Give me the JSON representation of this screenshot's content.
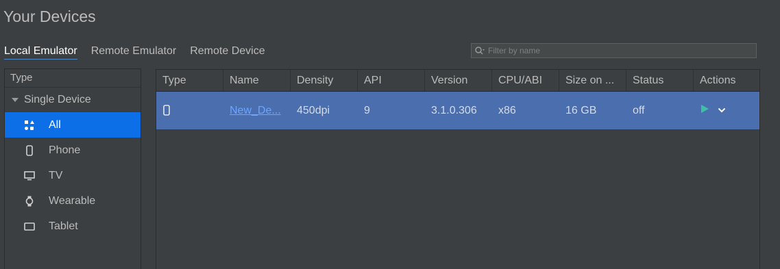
{
  "page": {
    "title": "Your Devices"
  },
  "tabs": [
    {
      "label": "Local Emulator",
      "active": true
    },
    {
      "label": "Remote Emulator",
      "active": false
    },
    {
      "label": "Remote Device",
      "active": false
    }
  ],
  "filter": {
    "placeholder": "Filter by name",
    "value": ""
  },
  "sidebar": {
    "header": "Type",
    "group": "Single Device",
    "items": [
      {
        "label": "All",
        "icon": "grid-shapes-icon",
        "selected": true
      },
      {
        "label": "Phone",
        "icon": "phone-icon",
        "selected": false
      },
      {
        "label": "TV",
        "icon": "tv-icon",
        "selected": false
      },
      {
        "label": "Wearable",
        "icon": "watch-icon",
        "selected": false
      },
      {
        "label": "Tablet",
        "icon": "tablet-icon",
        "selected": false
      }
    ]
  },
  "table": {
    "columns": [
      "Type",
      "Name",
      "Density",
      "API",
      "Version",
      "CPU/ABI",
      "Size on ...",
      "Status",
      "Actions"
    ],
    "rows": [
      {
        "type_icon": "phone-icon",
        "name": "New_De...",
        "density": "450dpi",
        "api": "9",
        "version": "3.1.0.306",
        "cpu": "x86",
        "size": "16 GB",
        "status": "off"
      }
    ]
  },
  "colors": {
    "background": "#3c3f41",
    "selection": "#0d6fe7",
    "row_selected": "#4b6eaf",
    "play": "#3cc0a8",
    "link": "#6aa5ff"
  }
}
